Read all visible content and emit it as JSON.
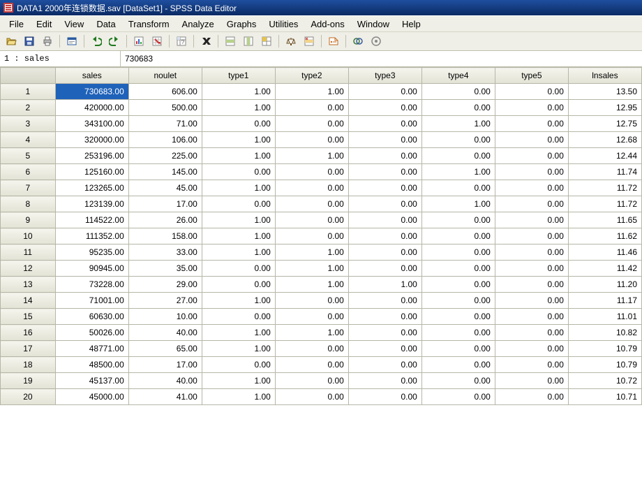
{
  "window": {
    "title": "DATA1 2000年连锁数据.sav [DataSet1] - SPSS Data Editor"
  },
  "menu": {
    "items": [
      "File",
      "Edit",
      "View",
      "Data",
      "Transform",
      "Analyze",
      "Graphs",
      "Utilities",
      "Add-ons",
      "Window",
      "Help"
    ]
  },
  "cellbar": {
    "address": "1 : sales",
    "value": "730683"
  },
  "columns": [
    "sales",
    "noulet",
    "type1",
    "type2",
    "type3",
    "type4",
    "type5",
    "lnsales"
  ],
  "rows": [
    {
      "n": "1",
      "cells": [
        "730683.00",
        "606.00",
        "1.00",
        "1.00",
        "0.00",
        "0.00",
        "0.00",
        "13.50"
      ]
    },
    {
      "n": "2",
      "cells": [
        "420000.00",
        "500.00",
        "1.00",
        "0.00",
        "0.00",
        "0.00",
        "0.00",
        "12.95"
      ]
    },
    {
      "n": "3",
      "cells": [
        "343100.00",
        "71.00",
        "0.00",
        "0.00",
        "0.00",
        "1.00",
        "0.00",
        "12.75"
      ]
    },
    {
      "n": "4",
      "cells": [
        "320000.00",
        "106.00",
        "1.00",
        "0.00",
        "0.00",
        "0.00",
        "0.00",
        "12.68"
      ]
    },
    {
      "n": "5",
      "cells": [
        "253196.00",
        "225.00",
        "1.00",
        "1.00",
        "0.00",
        "0.00",
        "0.00",
        "12.44"
      ]
    },
    {
      "n": "6",
      "cells": [
        "125160.00",
        "145.00",
        "0.00",
        "0.00",
        "0.00",
        "1.00",
        "0.00",
        "11.74"
      ]
    },
    {
      "n": "7",
      "cells": [
        "123265.00",
        "45.00",
        "1.00",
        "0.00",
        "0.00",
        "0.00",
        "0.00",
        "11.72"
      ]
    },
    {
      "n": "8",
      "cells": [
        "123139.00",
        "17.00",
        "0.00",
        "0.00",
        "0.00",
        "1.00",
        "0.00",
        "11.72"
      ]
    },
    {
      "n": "9",
      "cells": [
        "114522.00",
        "26.00",
        "1.00",
        "0.00",
        "0.00",
        "0.00",
        "0.00",
        "11.65"
      ]
    },
    {
      "n": "10",
      "cells": [
        "111352.00",
        "158.00",
        "1.00",
        "0.00",
        "0.00",
        "0.00",
        "0.00",
        "11.62"
      ]
    },
    {
      "n": "11",
      "cells": [
        "95235.00",
        "33.00",
        "1.00",
        "1.00",
        "0.00",
        "0.00",
        "0.00",
        "11.46"
      ]
    },
    {
      "n": "12",
      "cells": [
        "90945.00",
        "35.00",
        "0.00",
        "1.00",
        "0.00",
        "0.00",
        "0.00",
        "11.42"
      ]
    },
    {
      "n": "13",
      "cells": [
        "73228.00",
        "29.00",
        "0.00",
        "1.00",
        "1.00",
        "0.00",
        "0.00",
        "11.20"
      ]
    },
    {
      "n": "14",
      "cells": [
        "71001.00",
        "27.00",
        "1.00",
        "0.00",
        "0.00",
        "0.00",
        "0.00",
        "11.17"
      ]
    },
    {
      "n": "15",
      "cells": [
        "60630.00",
        "10.00",
        "0.00",
        "0.00",
        "0.00",
        "0.00",
        "0.00",
        "11.01"
      ]
    },
    {
      "n": "16",
      "cells": [
        "50026.00",
        "40.00",
        "1.00",
        "1.00",
        "0.00",
        "0.00",
        "0.00",
        "10.82"
      ]
    },
    {
      "n": "17",
      "cells": [
        "48771.00",
        "65.00",
        "1.00",
        "0.00",
        "0.00",
        "0.00",
        "0.00",
        "10.79"
      ]
    },
    {
      "n": "18",
      "cells": [
        "48500.00",
        "17.00",
        "0.00",
        "0.00",
        "0.00",
        "0.00",
        "0.00",
        "10.79"
      ]
    },
    {
      "n": "19",
      "cells": [
        "45137.00",
        "40.00",
        "1.00",
        "0.00",
        "0.00",
        "0.00",
        "0.00",
        "10.72"
      ]
    },
    {
      "n": "20",
      "cells": [
        "45000.00",
        "41.00",
        "1.00",
        "0.00",
        "0.00",
        "0.00",
        "0.00",
        "10.71"
      ]
    }
  ],
  "selected": {
    "row": 0,
    "col": 0
  },
  "toolbarIcons": [
    "open-icon",
    "save-icon",
    "print-icon",
    "sep",
    "dialog-recall-icon",
    "sep",
    "undo-icon",
    "redo-icon",
    "sep",
    "goto-chart-icon",
    "goto-case-icon",
    "sep",
    "variables-icon",
    "sep",
    "find-icon",
    "sep",
    "insert-case-icon",
    "insert-variable-icon",
    "split-file-icon",
    "sep",
    "weight-cases-icon",
    "select-cases-icon",
    "sep",
    "value-labels-icon",
    "sep",
    "use-sets-icon",
    "show-all-icon"
  ]
}
